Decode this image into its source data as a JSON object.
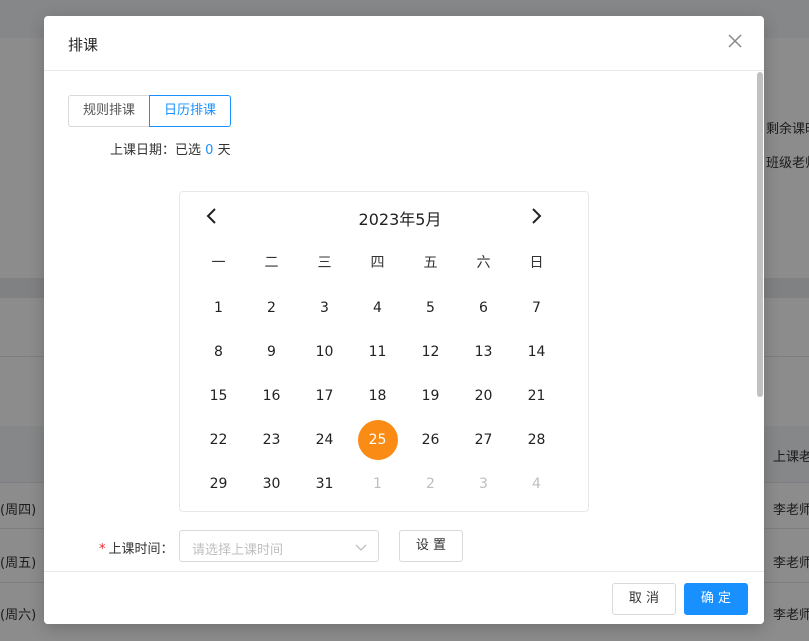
{
  "background": {
    "right_labels": [
      "剩余课时",
      "班级老师"
    ],
    "table_header": "上课老",
    "rows": [
      {
        "left": "(周四)",
        "right": "李老师"
      },
      {
        "left": "(周五)",
        "right": "李老师"
      },
      {
        "left": "(周六)",
        "right": "李老师"
      }
    ]
  },
  "modal": {
    "title": "排课",
    "close_icon": "close-icon"
  },
  "mode_tabs": [
    {
      "label": "规则排课",
      "active": false
    },
    {
      "label": "日历排课",
      "active": true
    }
  ],
  "date_summary": {
    "label": "上课日期：",
    "prefix": "已选",
    "count": "0",
    "suffix": "天"
  },
  "calendar": {
    "title": "2023年5月",
    "weekdays": [
      "一",
      "二",
      "三",
      "四",
      "五",
      "六",
      "日"
    ],
    "weeks": [
      [
        "1",
        "2",
        "3",
        "4",
        "5",
        "6",
        "7"
      ],
      [
        "8",
        "9",
        "10",
        "11",
        "12",
        "13",
        "14"
      ],
      [
        "15",
        "16",
        "17",
        "18",
        "19",
        "20",
        "21"
      ],
      [
        "22",
        "23",
        "24",
        "25",
        "26",
        "27",
        "28"
      ],
      [
        "29",
        "30",
        "31",
        "1",
        "2",
        "3",
        "4"
      ]
    ],
    "today": "25",
    "today_color": "#fa8c16"
  },
  "time_field": {
    "required_mark": "*",
    "label": "上课时间：",
    "placeholder": "请选择上课时间",
    "set_label": "设 置"
  },
  "footer": {
    "cancel_label": "取 消",
    "ok_label": "确 定",
    "primary_color": "#1890ff"
  }
}
